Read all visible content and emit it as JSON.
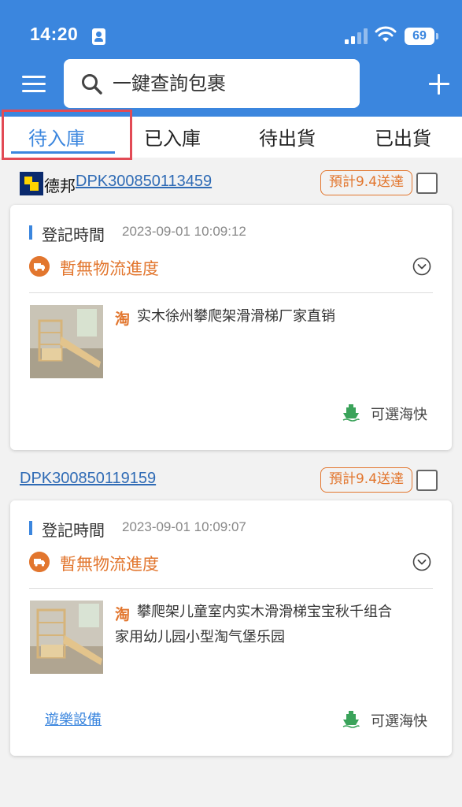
{
  "status_bar": {
    "time": "14:20",
    "battery": "69"
  },
  "header": {
    "search_placeholder": "一鍵查詢包裹"
  },
  "tabs": [
    {
      "label": "待入庫",
      "active": true
    },
    {
      "label": "已入庫",
      "active": false
    },
    {
      "label": "待出貨",
      "active": false
    },
    {
      "label": "已出貨",
      "active": false
    }
  ],
  "packages": [
    {
      "carrier": "德邦",
      "tracking_no": "DPK300850113459",
      "eta": "預計9.4送達",
      "reg_label": "登記時間",
      "reg_time": "2023-09-01 10:09:12",
      "logistics": "暫無物流進度",
      "platform_icon": "淘",
      "product_name": "实木徐州攀爬架滑滑梯厂家直销",
      "shipping": "可選海快"
    },
    {
      "tracking_no": "DPK300850119159",
      "eta": "預計9.4送達",
      "reg_label": "登記時間",
      "reg_time": "2023-09-01 10:09:07",
      "logistics": "暫無物流進度",
      "platform_icon": "淘",
      "product_name_line1": "攀爬架儿童室内实木滑滑梯宝宝秋千组合",
      "product_name_line2": "家用幼儿园小型淘气堡乐园",
      "category": "遊樂設備",
      "shipping": "可選海快"
    }
  ],
  "colors": {
    "primary": "#3b86de",
    "accent": "#e2762e",
    "highlight": "#e24a55",
    "ship": "#3aa35a"
  }
}
